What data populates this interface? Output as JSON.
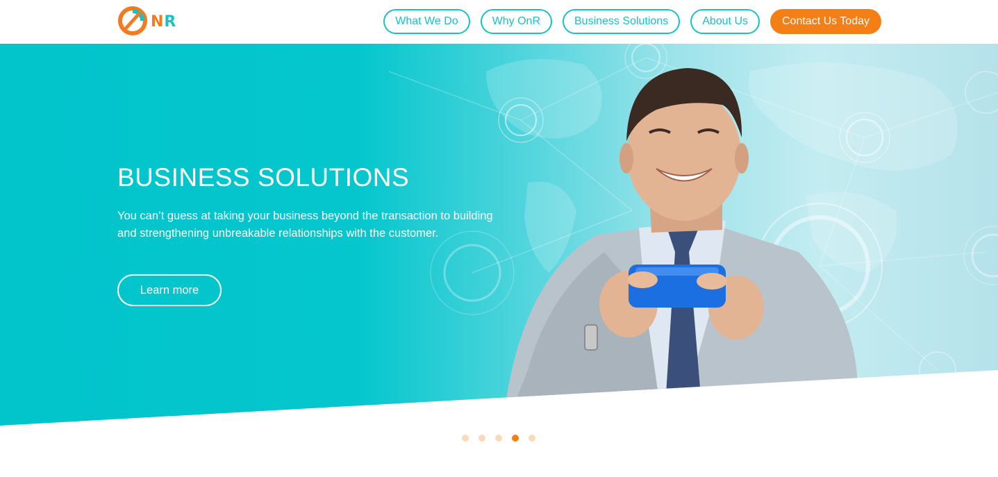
{
  "brand": {
    "logo_letters": "NR",
    "colors": {
      "orange": "#f57f17",
      "teal": "#16c1c9"
    }
  },
  "nav": {
    "items": [
      {
        "label": "What We Do"
      },
      {
        "label": "Why OnR"
      },
      {
        "label": "Business Solutions"
      },
      {
        "label": "About Us"
      }
    ],
    "cta_label": "Contact Us Today"
  },
  "hero": {
    "title": "BUSINESS SOLUTIONS",
    "text": "You can’t guess at taking your business beyond the transaction to building and strengthening unbreakable relationships with the customer.",
    "button_label": "Learn more",
    "image": "smiling-businessman-holding-phone"
  },
  "carousel": {
    "slide_count": 5,
    "active_index": 4
  }
}
